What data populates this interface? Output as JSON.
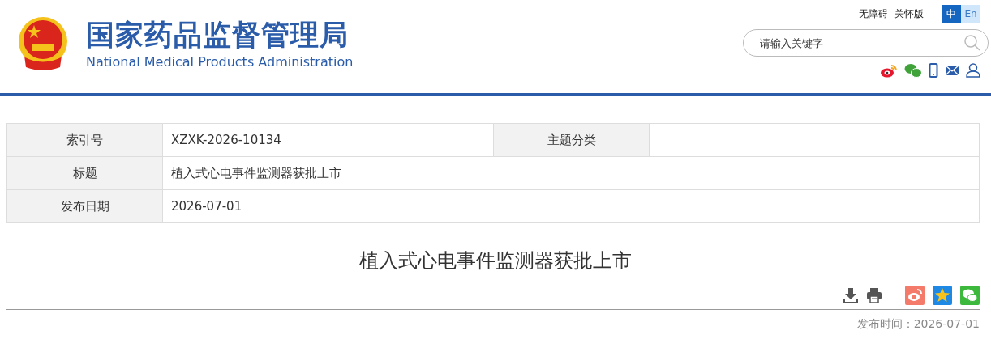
{
  "header": {
    "title": "国家药品监督管理局",
    "subtitle": "National Medical Products Administration",
    "links": [
      "无障碍",
      "关怀版"
    ],
    "languages": [
      {
        "label": "中",
        "selected": true
      },
      {
        "label": "En",
        "selected": false
      }
    ],
    "search": {
      "placeholder": "请输入关键字"
    }
  },
  "info_table": {
    "rows": [
      {
        "cells": [
          {
            "kind": "label",
            "text": "索引号"
          },
          {
            "kind": "value",
            "text": "XZXK-2026-10134"
          },
          {
            "kind": "label",
            "text": "主题分类"
          },
          {
            "kind": "empty"
          }
        ]
      },
      {
        "cells": [
          {
            "kind": "label",
            "text": "标题"
          },
          {
            "kind": "value",
            "text": "植入式心电事件监测器获批上市"
          }
        ]
      },
      {
        "cells": [
          {
            "kind": "label",
            "text": "发布日期"
          },
          {
            "kind": "value",
            "text": "2026-07-01"
          }
        ]
      }
    ]
  },
  "article": {
    "title": "植入式心电事件监测器获批上市",
    "publish_time": "发布时间：2026-07-01"
  }
}
